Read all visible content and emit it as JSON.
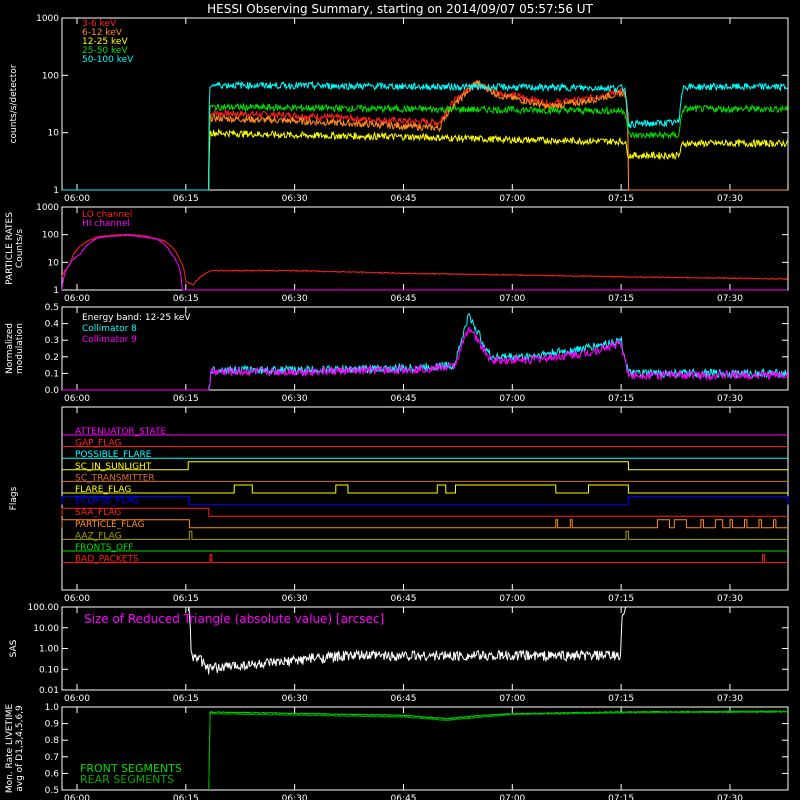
{
  "colors": {
    "background": "#000000",
    "axes": "#ffffff",
    "red": "#ff2020",
    "orange": "#ff8c1a",
    "yellow": "#ffff00",
    "green": "#00dd00",
    "cyan": "#00ffff",
    "magenta": "#ff00ff",
    "blue": "#0000ff",
    "darkgreen": "#00aa00",
    "olive": "#a8a000",
    "brown": "#d07030"
  },
  "chart_data": {
    "title": "HESSI Observing Summary, starting on 2014/09/07 05:57:56 UT",
    "time_axis": {
      "start": "05:57:56",
      "end": "07:38:00",
      "tick_labels": [
        "06:00",
        "06:15",
        "06:30",
        "06:45",
        "07:00",
        "07:15",
        "07:30"
      ],
      "tick_times": [
        "06:00",
        "06:15",
        "06:30",
        "06:45",
        "07:00",
        "07:15",
        "07:30"
      ]
    },
    "panels": [
      {
        "id": "count_rates",
        "type": "line",
        "ylabel": "counts/s/detector",
        "yscale": "log",
        "ylim": [
          1,
          1000
        ],
        "ytick_labels": [
          "1",
          "10",
          "100",
          "1000"
        ],
        "ytick_values": [
          1,
          10,
          100,
          1000
        ],
        "series": [
          {
            "name": "3-6 keV",
            "color_key": "red",
            "points": [
              [
                "05:57:56",
                1
              ],
              [
                "06:18:10",
                1
              ],
              [
                "06:18:20",
                22
              ],
              [
                "06:30:00",
                20
              ],
              [
                "06:40:00",
                17
              ],
              [
                "06:50:00",
                15
              ],
              [
                "06:53:00",
                45
              ],
              [
                "06:55:00",
                70
              ],
              [
                "06:58:00",
                50
              ],
              [
                "07:05:00",
                32
              ],
              [
                "07:10:00",
                38
              ],
              [
                "07:15:30",
                55
              ],
              [
                "07:16:00",
                1
              ],
              [
                "07:38:00",
                1
              ]
            ]
          },
          {
            "name": "6-12 keV",
            "color_key": "orange",
            "points": [
              [
                "05:57:56",
                1
              ],
              [
                "06:18:10",
                1
              ],
              [
                "06:18:20",
                18
              ],
              [
                "06:30:00",
                16
              ],
              [
                "06:40:00",
                14
              ],
              [
                "06:50:00",
                12
              ],
              [
                "06:53:00",
                40
              ],
              [
                "06:55:00",
                75
              ],
              [
                "06:58:00",
                45
              ],
              [
                "07:05:00",
                28
              ],
              [
                "07:10:00",
                35
              ],
              [
                "07:15:30",
                50
              ],
              [
                "07:16:00",
                1
              ],
              [
                "07:38:00",
                1
              ]
            ]
          },
          {
            "name": "12-25 keV",
            "color_key": "yellow",
            "points": [
              [
                "05:57:56",
                1
              ],
              [
                "06:18:10",
                1
              ],
              [
                "06:18:20",
                10
              ],
              [
                "06:30:00",
                9
              ],
              [
                "06:45:00",
                8.5
              ],
              [
                "07:00:00",
                7.5
              ],
              [
                "07:15:30",
                7
              ],
              [
                "07:16:00",
                4
              ],
              [
                "07:23:00",
                4
              ],
              [
                "07:23:30",
                6.5
              ],
              [
                "07:38:00",
                6.5
              ]
            ]
          },
          {
            "name": "25-50 keV",
            "color_key": "green",
            "points": [
              [
                "05:57:56",
                1
              ],
              [
                "06:18:10",
                1
              ],
              [
                "06:18:20",
                28
              ],
              [
                "06:45:00",
                26
              ],
              [
                "07:00:00",
                25
              ],
              [
                "07:15:30",
                24
              ],
              [
                "07:16:00",
                9
              ],
              [
                "07:23:00",
                9
              ],
              [
                "07:23:30",
                26
              ],
              [
                "07:38:00",
                26
              ]
            ]
          },
          {
            "name": "50-100 keV",
            "color_key": "cyan",
            "points": [
              [
                "05:57:56",
                1
              ],
              [
                "06:18:10",
                1
              ],
              [
                "06:18:20",
                68
              ],
              [
                "06:45:00",
                64
              ],
              [
                "07:00:00",
                62
              ],
              [
                "07:15:30",
                60
              ],
              [
                "07:16:00",
                14
              ],
              [
                "07:23:00",
                15
              ],
              [
                "07:23:30",
                63
              ],
              [
                "07:38:00",
                63
              ]
            ]
          }
        ]
      },
      {
        "id": "particle_rates",
        "type": "line",
        "ylabel": "PARTICLE RATES Counts/s",
        "yscale": "log",
        "ylim": [
          1,
          1000
        ],
        "ytick_labels": [
          "1",
          "10",
          "100",
          "1000"
        ],
        "ytick_values": [
          1,
          10,
          100,
          1000
        ],
        "series": [
          {
            "name": "LO channel",
            "color_key": "red",
            "points": [
              [
                "05:57:56",
                3
              ],
              [
                "05:59:00",
                8
              ],
              [
                "06:01:00",
                50
              ],
              [
                "06:03:00",
                85
              ],
              [
                "06:06:00",
                100
              ],
              [
                "06:09:00",
                95
              ],
              [
                "06:12:00",
                60
              ],
              [
                "06:14:00",
                15
              ],
              [
                "06:15:00",
                2
              ],
              [
                "06:16:00",
                1.5
              ],
              [
                "06:18:30",
                5
              ],
              [
                "06:30:00",
                5
              ],
              [
                "06:45:00",
                4
              ],
              [
                "07:00:00",
                3.5
              ],
              [
                "07:15:00",
                3
              ],
              [
                "07:38:00",
                2.5
              ]
            ]
          },
          {
            "name": "HI channel",
            "color_key": "magenta",
            "points": [
              [
                "05:57:56",
                1
              ],
              [
                "06:00:30",
                20
              ],
              [
                "06:03:00",
                80
              ],
              [
                "06:07:00",
                98
              ],
              [
                "06:11:00",
                70
              ],
              [
                "06:13:00",
                20
              ],
              [
                "06:14:30",
                1
              ],
              [
                "07:38:00",
                1
              ]
            ]
          }
        ]
      },
      {
        "id": "modulation",
        "type": "line",
        "ylabel": "Normalized modulation",
        "ylim": [
          0,
          0.5
        ],
        "ytick_labels": [
          "0.0",
          "0.1",
          "0.2",
          "0.3",
          "0.4",
          "0.5"
        ],
        "ytick_values": [
          0,
          0.1,
          0.2,
          0.3,
          0.4,
          0.5
        ],
        "annotation": "Energy band: 12-25 keV",
        "series": [
          {
            "name": "Collimator 8",
            "color_key": "cyan",
            "points": [
              [
                "05:57:56",
                0
              ],
              [
                "06:18:10",
                0
              ],
              [
                "06:18:30",
                0.12
              ],
              [
                "06:30:00",
                0.12
              ],
              [
                "06:45:00",
                0.13
              ],
              [
                "06:52:00",
                0.15
              ],
              [
                "06:54:00",
                0.45
              ],
              [
                "06:57:00",
                0.2
              ],
              [
                "07:02:00",
                0.2
              ],
              [
                "07:10:00",
                0.25
              ],
              [
                "07:15:00",
                0.3
              ],
              [
                "07:16:00",
                0.1
              ],
              [
                "07:38:00",
                0.1
              ]
            ]
          },
          {
            "name": "Collimator 9",
            "color_key": "magenta",
            "points": [
              [
                "05:57:56",
                0
              ],
              [
                "06:18:10",
                0
              ],
              [
                "06:18:30",
                0.11
              ],
              [
                "06:30:00",
                0.11
              ],
              [
                "06:45:00",
                0.12
              ],
              [
                "06:52:00",
                0.14
              ],
              [
                "06:54:00",
                0.38
              ],
              [
                "06:57:00",
                0.18
              ],
              [
                "07:02:00",
                0.18
              ],
              [
                "07:10:00",
                0.22
              ],
              [
                "07:15:00",
                0.28
              ],
              [
                "07:16:00",
                0.09
              ],
              [
                "07:38:00",
                0.09
              ]
            ]
          }
        ]
      },
      {
        "id": "flags",
        "type": "flags",
        "ylabel": "Flags",
        "flags": [
          {
            "name": "ATTENUATOR_STATE",
            "color_key": "magenta",
            "on": []
          },
          {
            "name": "GAP_FLAG",
            "color_key": "red",
            "on": []
          },
          {
            "name": "POSSIBLE_FLARE",
            "color_key": "cyan",
            "on": []
          },
          {
            "name": "SC_IN_SUNLIGHT",
            "color_key": "yellow",
            "on": [
              [
                "06:15:20",
                "07:16:00"
              ]
            ]
          },
          {
            "name": "SC_TRANSMITTER",
            "color_key": "brown",
            "on": []
          },
          {
            "name": "FLARE_FLAG",
            "color_key": "yellow",
            "on": [
              [
                "06:21:40",
                "06:24:10"
              ],
              [
                "06:35:40",
                "06:37:20"
              ],
              [
                "06:49:40",
                "06:50:50"
              ],
              [
                "06:52:10",
                "07:06:00"
              ],
              [
                "07:10:30",
                "07:16:00"
              ]
            ]
          },
          {
            "name": "ECLIPSE_FLAG",
            "color_key": "blue",
            "on": [
              [
                "05:57:56",
                "06:15:30"
              ],
              [
                "07:16:00",
                "07:38:00"
              ]
            ]
          },
          {
            "name": "SAA_FLAG",
            "color_key": "red",
            "on": [
              [
                "05:57:56",
                "06:18:10"
              ]
            ]
          },
          {
            "name": "PARTICLE_FLAG",
            "color_key": "orange",
            "on": [
              [
                "05:57:56",
                "06:15:30"
              ],
              [
                "07:06:00",
                "07:06:15"
              ],
              [
                "07:08:00",
                "07:08:15"
              ],
              [
                "07:20:00",
                "07:21:40"
              ],
              [
                "07:22:20",
                "07:24:00"
              ],
              [
                "07:26:00",
                "07:26:20"
              ],
              [
                "07:28:00",
                "07:29:00"
              ],
              [
                "07:30:00",
                "07:30:20"
              ],
              [
                "07:32:00",
                "07:32:20"
              ],
              [
                "07:34:00",
                "07:34:20"
              ],
              [
                "07:36:00",
                "07:36:20"
              ]
            ]
          },
          {
            "name": "AAZ_FLAG",
            "color_key": "olive",
            "on": [
              [
                "06:15:30",
                "06:15:50"
              ],
              [
                "07:15:40",
                "07:16:00"
              ]
            ]
          },
          {
            "name": "FRONTS_OFF",
            "color_key": "green",
            "on": []
          },
          {
            "name": "BAD_PACKETS",
            "color_key": "red",
            "on": [
              [
                "06:18:20",
                "06:18:35"
              ],
              [
                "07:34:30",
                "07:34:45"
              ]
            ]
          }
        ]
      },
      {
        "id": "sas",
        "type": "line",
        "ylabel": "SAS",
        "yscale": "log",
        "ylim": [
          0.01,
          100
        ],
        "ytick_labels": [
          "0.01",
          "0.10",
          "1.00",
          "10.00",
          "100.00"
        ],
        "ytick_values": [
          0.01,
          0.1,
          1,
          10,
          100
        ],
        "annotation": "Size of Reduced Triangle (absolute value) [arcsec]",
        "series": [
          {
            "name": "",
            "color_key": "axes",
            "points": [
              [
                "06:15:20",
                100
              ],
              [
                "06:15:40",
                0.5
              ],
              [
                "06:18:00",
                0.1
              ],
              [
                "06:22:00",
                0.15
              ],
              [
                "06:28:00",
                0.2
              ],
              [
                "06:33:00",
                0.35
              ],
              [
                "06:38:00",
                0.45
              ],
              [
                "06:50:00",
                0.45
              ],
              [
                "07:05:00",
                0.45
              ],
              [
                "07:15:00",
                0.45
              ],
              [
                "07:15:40",
                100
              ]
            ]
          }
        ]
      },
      {
        "id": "livetime",
        "type": "line",
        "ylabel": "Mon. Rate LIVETIME avg of D1,3,4,5,6,9",
        "ylim": [
          0.5,
          1.0
        ],
        "ytick_labels": [
          "0.5",
          "0.6",
          "0.7",
          "0.8",
          "0.9",
          "1.0"
        ],
        "ytick_values": [
          0.5,
          0.6,
          0.7,
          0.8,
          0.9,
          1.0
        ],
        "series": [
          {
            "name": "FRONT SEGMENTS",
            "color_key": "green",
            "points": [
              [
                "06:18:10",
                0.5
              ],
              [
                "06:18:20",
                0.97
              ],
              [
                "06:45:00",
                0.95
              ],
              [
                "06:51:00",
                0.93
              ],
              [
                "06:56:00",
                0.95
              ],
              [
                "07:00:00",
                0.96
              ],
              [
                "07:15:00",
                0.97
              ],
              [
                "07:38:00",
                0.975
              ]
            ]
          },
          {
            "name": "REAR SEGMENTS",
            "color_key": "darkgreen",
            "points": [
              [
                "06:18:10",
                0.5
              ],
              [
                "06:18:20",
                0.96
              ],
              [
                "06:45:00",
                0.94
              ],
              [
                "06:51:00",
                0.92
              ],
              [
                "06:56:00",
                0.94
              ],
              [
                "07:00:00",
                0.955
              ],
              [
                "07:15:00",
                0.965
              ],
              [
                "07:38:00",
                0.97
              ]
            ]
          }
        ]
      }
    ]
  }
}
